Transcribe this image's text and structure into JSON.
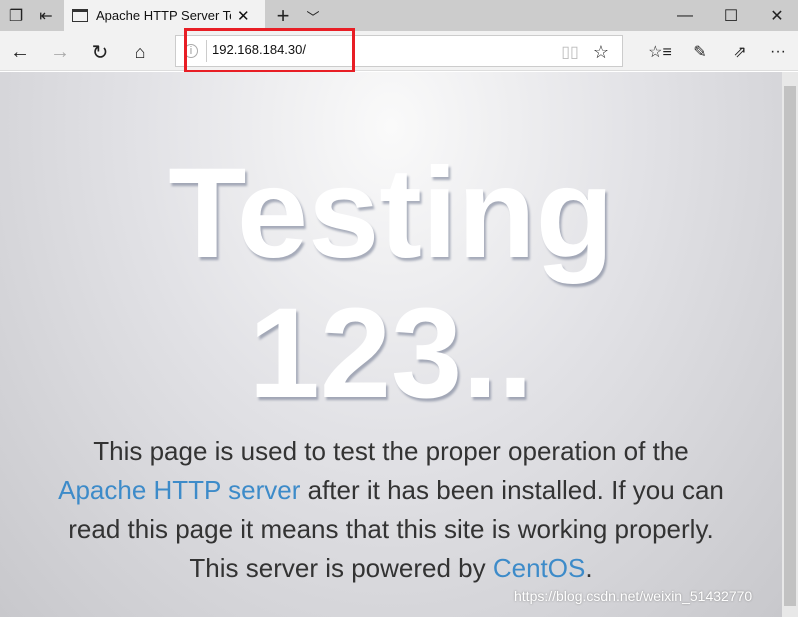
{
  "tab": {
    "title": "Apache HTTP Server Test Page powered by CentOS"
  },
  "address": {
    "url": "192.168.184.30/"
  },
  "page": {
    "heading_line1": "Testing",
    "heading_line2": "123..",
    "p1": "This page is used to test the proper operation of the ",
    "link1": "Apache HTTP server",
    "p2": " after it has been installed. If you can read this page it means that this site is working properly. This server is powered by ",
    "link2": "CentOS",
    "p3": "."
  },
  "watermark": "https://blog.csdn.net/weixin_51432770",
  "colors": {
    "highlight": "#e81e25",
    "link": "#3d8bc9"
  }
}
